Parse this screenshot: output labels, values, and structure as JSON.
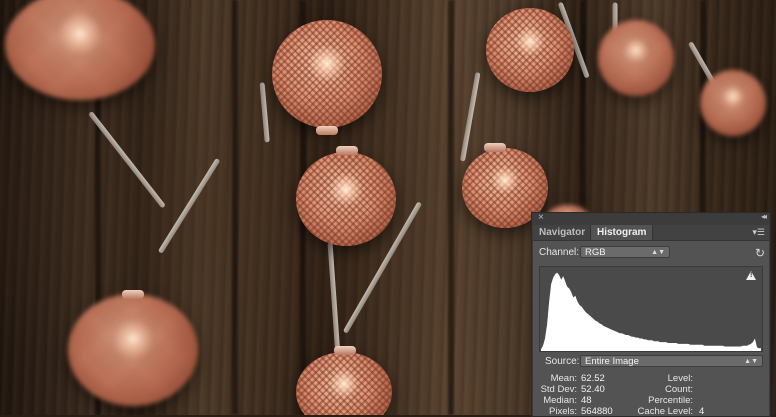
{
  "panel": {
    "close_icon": "close-icon",
    "collapse_icon": "double-arrow-icon",
    "tabs": [
      {
        "label": "Navigator",
        "active": false
      },
      {
        "label": "Histogram",
        "active": true
      }
    ],
    "menu_icon": "panel-menu-icon",
    "channel_label": "Channel:",
    "channel_value": "RGB",
    "refresh_icon": "refresh-icon",
    "warning_icon": "cache-warning-icon",
    "source_label": "Source:",
    "source_value": "Entire Image",
    "stats_left": [
      {
        "label": "Mean:",
        "value": "62.52"
      },
      {
        "label": "Std Dev:",
        "value": "52.40"
      },
      {
        "label": "Median:",
        "value": "48"
      },
      {
        "label": "Pixels:",
        "value": "564880"
      }
    ],
    "stats_right": [
      {
        "label": "Level:",
        "value": ""
      },
      {
        "label": "Count:",
        "value": ""
      },
      {
        "label": "Percentile:",
        "value": ""
      },
      {
        "label": "Cache Level:",
        "value": "4"
      }
    ],
    "histogram_shape": [
      2,
      6,
      14,
      30,
      55,
      75,
      82,
      86,
      88,
      85,
      80,
      84,
      78,
      72,
      70,
      66,
      60,
      62,
      56,
      52,
      50,
      47,
      44,
      42,
      40,
      38,
      36,
      34,
      33,
      31,
      30,
      28,
      27,
      26,
      25,
      24,
      23,
      22,
      21,
      20,
      20,
      19,
      18,
      18,
      17,
      16,
      16,
      15,
      15,
      14,
      14,
      13,
      13,
      12,
      12,
      12,
      11,
      11,
      11,
      10,
      10,
      10,
      10,
      9,
      9,
      9,
      9,
      9,
      8,
      8,
      8,
      8,
      8,
      8,
      7,
      7,
      7,
      7,
      7,
      7,
      7,
      6,
      6,
      6,
      6,
      6,
      6,
      6,
      6,
      6,
      6,
      5,
      5,
      5,
      5,
      5,
      5,
      5,
      5,
      5,
      6,
      6,
      6,
      7,
      8,
      10,
      14,
      4,
      3,
      3
    ]
  },
  "colors": {
    "panel_bg": "#535353",
    "panel_titlebar": "#3c3c3c",
    "histogram_fill": "#ffffff",
    "histogram_bg": "#4a4a4a"
  }
}
